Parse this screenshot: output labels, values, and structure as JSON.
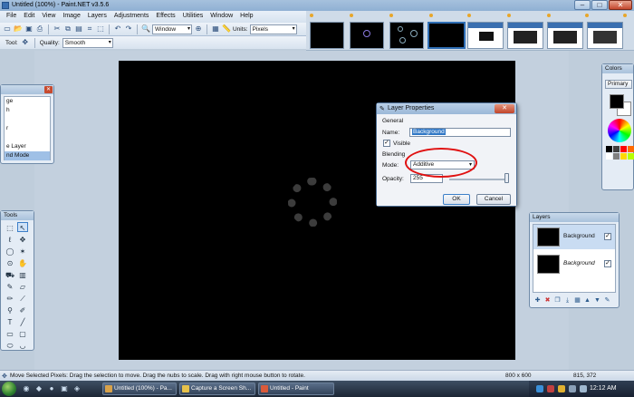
{
  "window": {
    "title": "Untitled (100%) - Paint.NET v3.5.6"
  },
  "menu": [
    "File",
    "Edit",
    "View",
    "Image",
    "Layers",
    "Adjustments",
    "Effects",
    "Utilities",
    "Window",
    "Help"
  ],
  "toolbar": {
    "window_dropdown": "Window",
    "units_label": "Units:",
    "units_value": "Pixels",
    "tool_label": "Tool:",
    "quality_label": "Quality:",
    "quality_value": "Smooth"
  },
  "history": {
    "items": [
      "ge",
      "h",
      "",
      "r",
      "",
      "e Layer",
      "nd Mode"
    ]
  },
  "tools_panel": {
    "title": "Tools"
  },
  "colors_panel": {
    "title": "Colors",
    "primary_label": "Primary"
  },
  "layers_panel": {
    "title": "Layers",
    "rows": [
      {
        "name": "Background",
        "checked": "✓"
      },
      {
        "name": "Background",
        "checked": "✓"
      }
    ]
  },
  "dialog": {
    "title": "Layer Properties",
    "general_label": "General",
    "name_label": "Name:",
    "name_value": "Background",
    "visible_label": "Visible",
    "visible_check": "✓",
    "blending_label": "Blending",
    "mode_label": "Mode:",
    "mode_value": "Additive",
    "opacity_label": "Opacity:",
    "opacity_value": "255",
    "ok_label": "OK",
    "cancel_label": "Cancel"
  },
  "status": {
    "message": "Move Selected Pixels: Drag the selection to move. Drag the nubs to scale. Drag with right mouse button to rotate.",
    "image_size": "800 x 600",
    "cursor": "815, 372"
  },
  "taskbar": {
    "tasks": [
      "Untitled (100%) - Pa...",
      "Capture a Screen Sh...",
      "Untitled - Paint"
    ],
    "time": "12:12 AM"
  }
}
